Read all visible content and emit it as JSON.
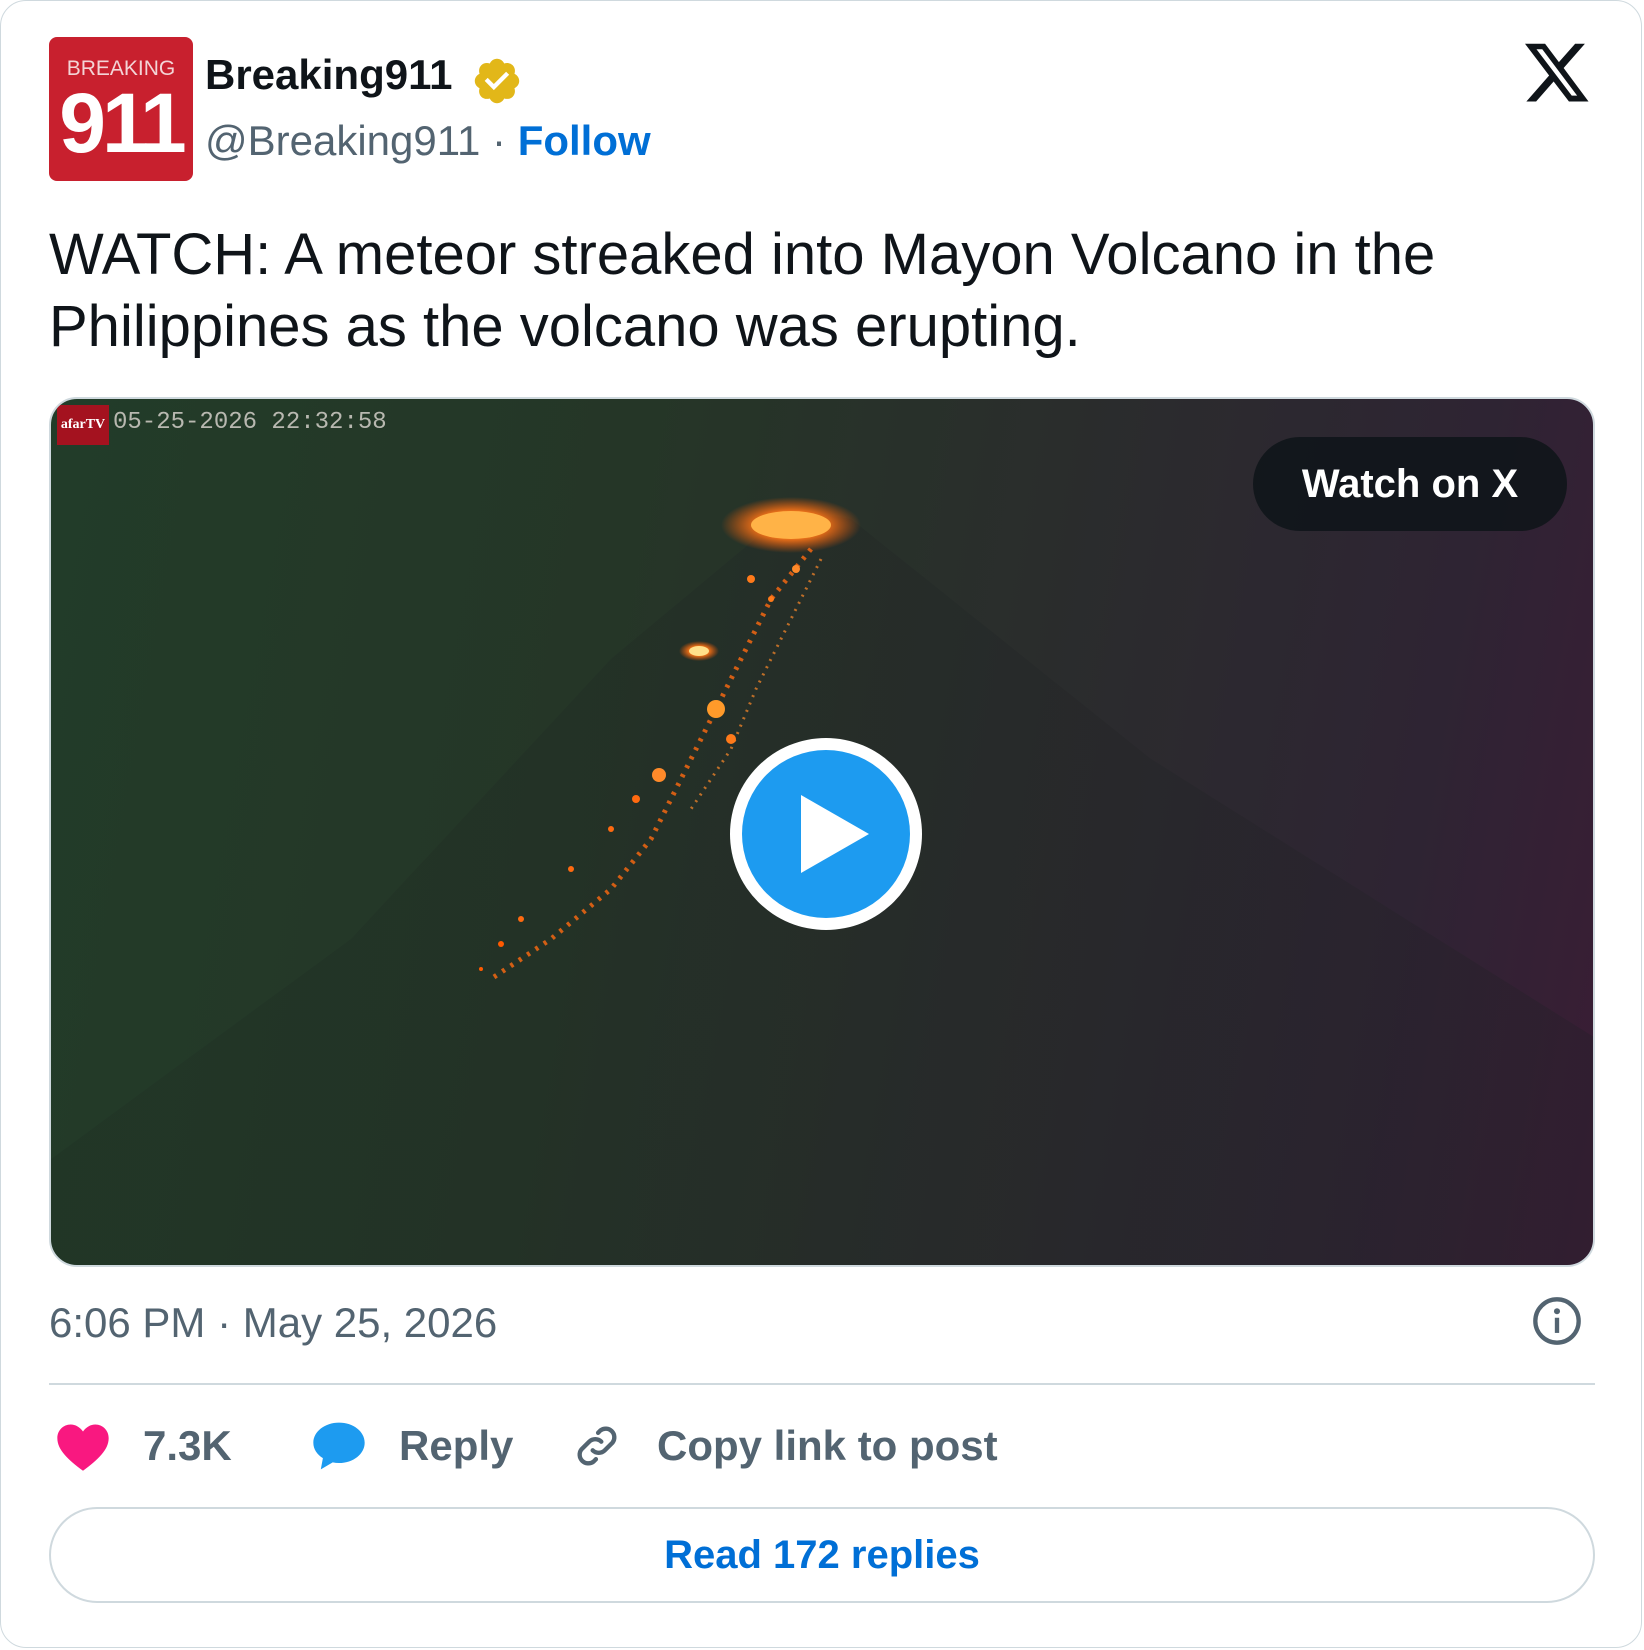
{
  "author": {
    "avatar_top_text": "BREAKING",
    "avatar_number": "911",
    "display_name": "Breaking911",
    "handle": "@Breaking911",
    "separator": "·",
    "follow_label": "Follow"
  },
  "tweet": {
    "text": "WATCH: A meteor streaked into Mayon Volcano in the Philippines as the volcano was erupting."
  },
  "media": {
    "camera_logo": "afarTV",
    "camera_timestamp": "05-25-2026 22:32:58",
    "watch_label": "Watch on X"
  },
  "meta": {
    "timestamp": "6:06 PM · May 25, 2026"
  },
  "actions": {
    "likes": "7.3K",
    "reply_label": "Reply",
    "copy_label": "Copy link to post"
  },
  "read_replies_label": "Read 172 replies",
  "colors": {
    "follow_blue": "#006fd6",
    "verified_gold": "#e2b719",
    "like_pink": "#f91880",
    "reply_blue": "#1d9bf0",
    "play_blue": "#1d9bf0"
  }
}
